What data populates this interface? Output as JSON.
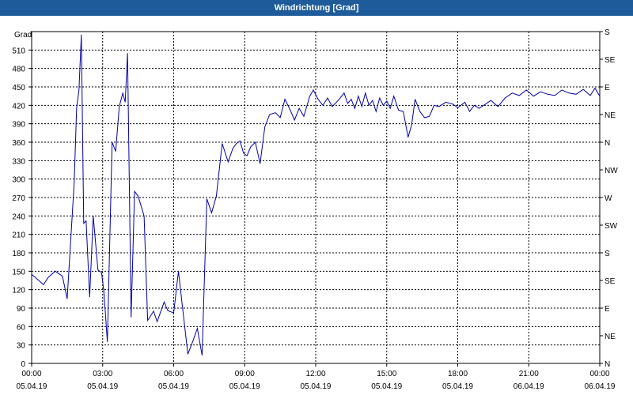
{
  "window": {
    "title": "Windrichtung [Grad]"
  },
  "chart_data": {
    "type": "line",
    "title": "Windrichtung [Grad]",
    "ylabel": "Grad",
    "ylim": [
      0,
      540
    ],
    "y_ticks": [
      0,
      30,
      60,
      90,
      120,
      150,
      180,
      210,
      240,
      270,
      300,
      330,
      360,
      390,
      420,
      450,
      480,
      510
    ],
    "right_axis_labels": [
      "N",
      "NE",
      "E",
      "SE",
      "S",
      "SW",
      "W",
      "NW",
      "N",
      "NE",
      "E",
      "SE",
      "S"
    ],
    "x_ticks": [
      {
        "time": "00:00",
        "date": "05.04.19"
      },
      {
        "time": "03:00",
        "date": "05.04.19"
      },
      {
        "time": "06:00",
        "date": "05.04.19"
      },
      {
        "time": "09:00",
        "date": "05.04.19"
      },
      {
        "time": "12:00",
        "date": "05.04.19"
      },
      {
        "time": "15:00",
        "date": "05.04.19"
      },
      {
        "time": "18:00",
        "date": "05.04.19"
      },
      {
        "time": "21:00",
        "date": "06.04.19"
      },
      {
        "time": "00:00",
        "date": "06.04.19"
      }
    ],
    "grid": true,
    "line_color": "#0000aa",
    "series": [
      {
        "x": [
          0.0,
          0.3,
          0.5,
          0.7,
          1.0,
          1.3,
          1.5,
          1.8,
          1.9,
          2.0,
          2.1,
          2.2,
          2.3,
          2.45,
          2.6,
          2.8,
          2.95,
          3.05,
          3.2,
          3.4,
          3.55,
          3.7,
          3.85,
          3.95,
          4.05,
          4.2,
          4.35,
          4.5,
          4.75,
          4.9,
          5.15,
          5.3,
          5.6,
          5.75,
          6.0,
          6.2,
          6.6,
          6.8,
          7.0,
          7.2,
          7.4,
          7.6,
          7.8,
          8.05,
          8.3,
          8.5,
          8.65,
          8.8,
          8.95,
          9.1,
          9.25,
          9.45,
          9.65,
          9.85,
          10.05,
          10.3,
          10.5,
          10.7,
          10.95,
          11.1,
          11.3,
          11.5,
          11.75,
          11.9,
          12.1,
          12.3,
          12.5,
          12.7,
          12.95,
          13.2,
          13.35,
          13.5,
          13.65,
          13.8,
          13.95,
          14.1,
          14.25,
          14.4,
          14.55,
          14.7,
          14.85,
          15.0,
          15.15,
          15.3,
          15.5,
          15.7,
          15.9,
          16.05,
          16.2,
          16.4,
          16.6,
          16.8,
          17.0,
          17.2,
          17.5,
          17.8,
          18.0,
          18.3,
          18.5,
          18.7,
          18.9,
          19.1,
          19.4,
          19.7,
          20.0,
          20.3,
          20.6,
          20.9,
          21.2,
          21.5,
          21.8,
          22.1,
          22.4,
          22.7,
          23.0,
          23.3,
          23.6,
          23.8,
          24.0
        ],
        "y": [
          145,
          135,
          128,
          140,
          150,
          142,
          105,
          295,
          415,
          445,
          535,
          228,
          232,
          108,
          240,
          152,
          148,
          118,
          35,
          360,
          345,
          418,
          440,
          425,
          505,
          75,
          280,
          272,
          240,
          70,
          85,
          68,
          100,
          86,
          82,
          150,
          15,
          35,
          57,
          13,
          268,
          245,
          272,
          358,
          328,
          350,
          358,
          362,
          342,
          338,
          352,
          360,
          325,
          385,
          405,
          408,
          400,
          430,
          410,
          396,
          415,
          402,
          435,
          445,
          430,
          420,
          432,
          418,
          428,
          440,
          423,
          430,
          415,
          435,
          418,
          440,
          420,
          428,
          410,
          432,
          420,
          427,
          415,
          435,
          412,
          410,
          368,
          388,
          430,
          410,
          400,
          402,
          420,
          418,
          425,
          422,
          416,
          425,
          410,
          420,
          415,
          420,
          428,
          418,
          432,
          440,
          436,
          445,
          435,
          442,
          438,
          436,
          445,
          440,
          438,
          446,
          436,
          448,
          435
        ]
      }
    ]
  }
}
